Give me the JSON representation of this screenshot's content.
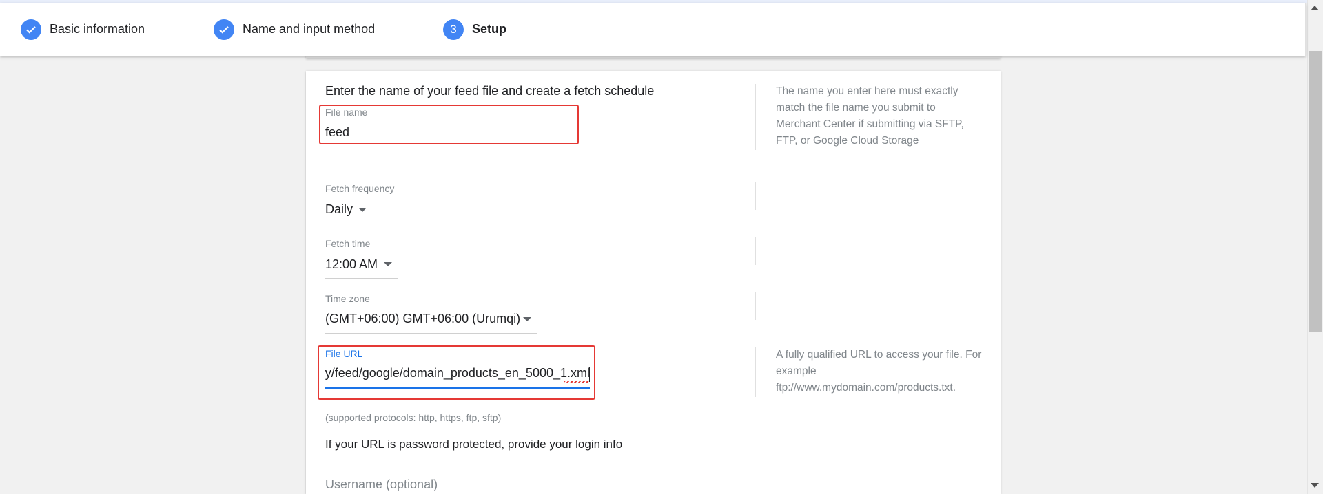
{
  "stepper": {
    "steps": [
      {
        "label": "Basic information",
        "state": "complete",
        "icon": "checkmark-icon"
      },
      {
        "label": "Name and input method",
        "state": "complete",
        "icon": "checkmark-icon"
      },
      {
        "label": "Setup",
        "state": "current",
        "number": "3"
      }
    ]
  },
  "form": {
    "heading": "Enter the name of your feed file and create a fetch schedule",
    "file_name": {
      "label": "File name",
      "value": "feed"
    },
    "file_name_help": "The name you enter here must exactly match the file name you submit to Merchant Center if submitting via SFTP, FTP, or Google Cloud Storage",
    "fetch_frequency": {
      "label": "Fetch frequency",
      "value": "Daily"
    },
    "fetch_time": {
      "label": "Fetch time",
      "value": "12:00 AM"
    },
    "time_zone": {
      "label": "Time zone",
      "value": "(GMT+06:00) GMT+06:00 (Urumqi)"
    },
    "file_url": {
      "label": "File URL",
      "value": "y/feed/google/domain_products_en_5000_1.xml"
    },
    "file_url_help": "A fully qualified URL to access your file. For example ftp://www.mydomain.com/products.txt.",
    "protocols_note": "(supported protocols: http, https, ftp, sftp)",
    "password_note": "If your URL is password protected, provide your login info",
    "username": {
      "placeholder": "Username (optional)"
    }
  },
  "colors": {
    "accent": "#4285f4",
    "focus_blue": "#1a73e8",
    "highlight_red": "#e53935"
  }
}
